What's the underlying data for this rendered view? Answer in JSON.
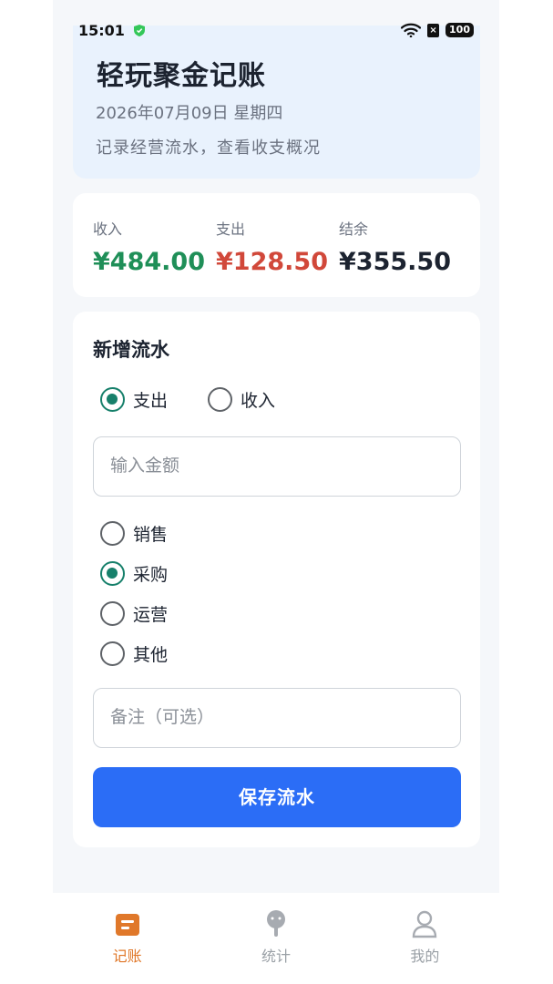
{
  "status_bar": {
    "time": "15:01",
    "battery": "100",
    "sim_badge": "×"
  },
  "header": {
    "title": "轻玩聚金记账",
    "date": "2026年07月09日 星期四",
    "subtitle": "记录经营流水，查看收支概况"
  },
  "summary": {
    "income_label": "收入",
    "income_value": "¥484.00",
    "expense_label": "支出",
    "expense_value": "¥128.50",
    "balance_label": "结余",
    "balance_value": "¥355.50"
  },
  "form": {
    "title": "新增流水",
    "type_options": [
      {
        "label": "支出",
        "checked": true
      },
      {
        "label": "收入",
        "checked": false
      }
    ],
    "amount_placeholder": "输入金额",
    "category_options": [
      {
        "label": "销售",
        "checked": false
      },
      {
        "label": "采购",
        "checked": true
      },
      {
        "label": "运营",
        "checked": false
      },
      {
        "label": "其他",
        "checked": false
      }
    ],
    "note_placeholder": "备注（可选）",
    "save_label": "保存流水"
  },
  "nav": {
    "items": [
      {
        "label": "记账",
        "icon": "ledger-icon",
        "active": true
      },
      {
        "label": "统计",
        "icon": "stats-icon",
        "active": false
      },
      {
        "label": "我的",
        "icon": "profile-icon",
        "active": false
      }
    ]
  },
  "colors": {
    "income": "#1f8f58",
    "expense": "#d1483a",
    "accent": "#17806b",
    "primary_button": "#2b6df6",
    "nav_active": "#e0782a"
  }
}
